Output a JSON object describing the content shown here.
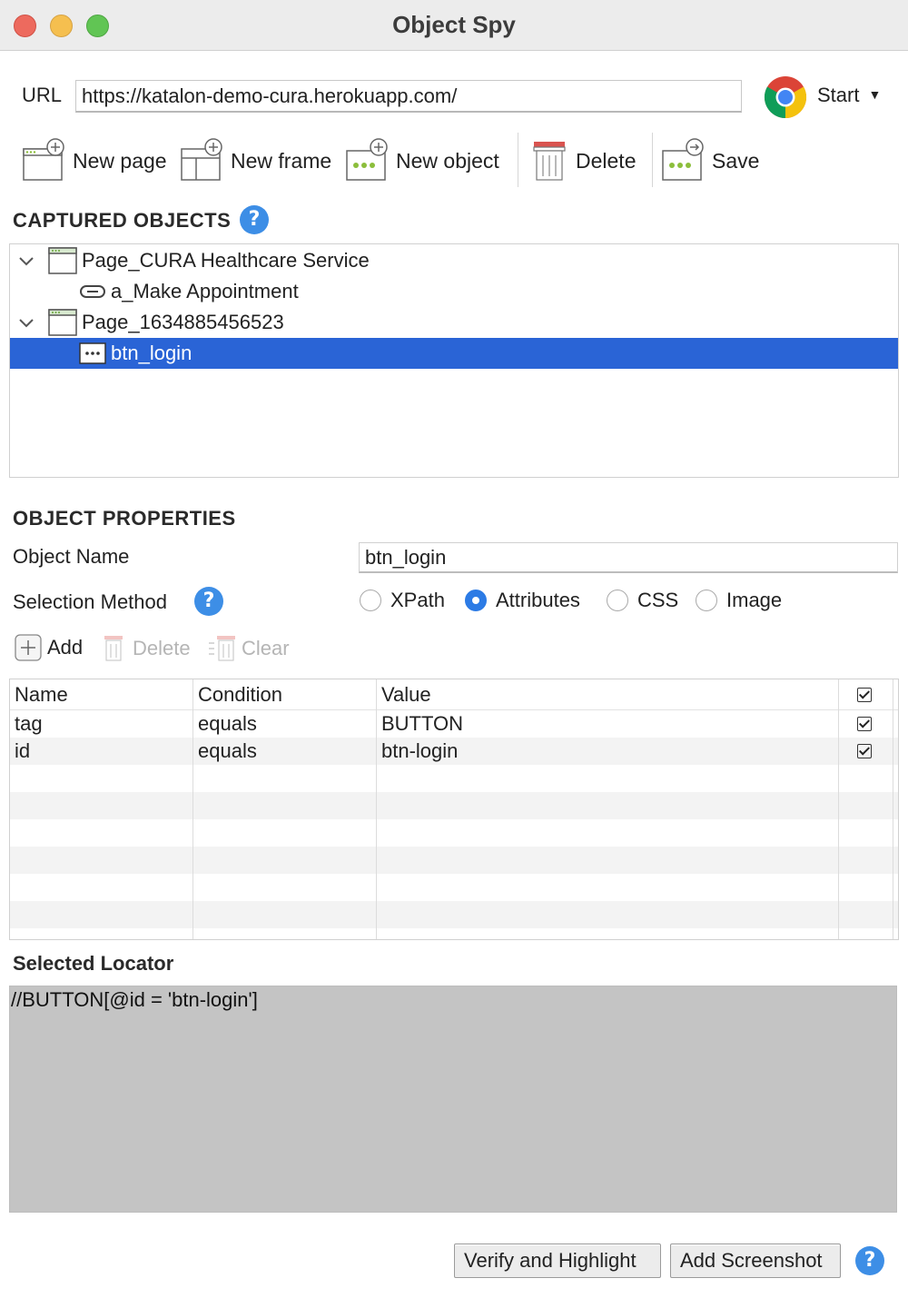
{
  "window": {
    "title": "Object Spy"
  },
  "url_bar": {
    "label": "URL",
    "value": "https://katalon-demo-cura.herokuapp.com/"
  },
  "browser": {
    "icon": "chrome-icon",
    "start_label": "Start"
  },
  "toolbar": {
    "new_page": "New page",
    "new_frame": "New frame",
    "new_object": "New object",
    "delete": "Delete",
    "save": "Save"
  },
  "captured": {
    "heading": "CAPTURED OBJECTS",
    "items": [
      {
        "label": "Page_CURA Healthcare Service",
        "type": "page",
        "expanded": true
      },
      {
        "label": "a_Make Appointment",
        "type": "link"
      },
      {
        "label": "Page_1634885456523",
        "type": "page",
        "expanded": true
      },
      {
        "label": "btn_login",
        "type": "button",
        "selected": true
      }
    ]
  },
  "properties": {
    "heading": "OBJECT PROPERTIES",
    "object_name_label": "Object Name",
    "object_name_value": "btn_login",
    "selection_method_label": "Selection Method",
    "methods": [
      "XPath",
      "Attributes",
      "CSS",
      "Image"
    ],
    "selected_method": "Attributes",
    "actions": {
      "add": "Add",
      "delete": "Delete",
      "clear": "Clear"
    }
  },
  "attributes_table": {
    "columns": [
      "Name",
      "Condition",
      "Value"
    ],
    "rows": [
      {
        "name": "tag",
        "condition": "equals",
        "value": "BUTTON",
        "checked": true
      },
      {
        "name": "id",
        "condition": "equals",
        "value": "btn-login",
        "checked": true
      }
    ]
  },
  "locator": {
    "heading": "Selected Locator",
    "value": "//BUTTON[@id = 'btn-login']"
  },
  "footer": {
    "verify": "Verify and Highlight",
    "screenshot": "Add Screenshot"
  },
  "colors": {
    "selection": "#2a64d6",
    "help": "#3d8ee6",
    "radio_on": "#2c7be5"
  }
}
